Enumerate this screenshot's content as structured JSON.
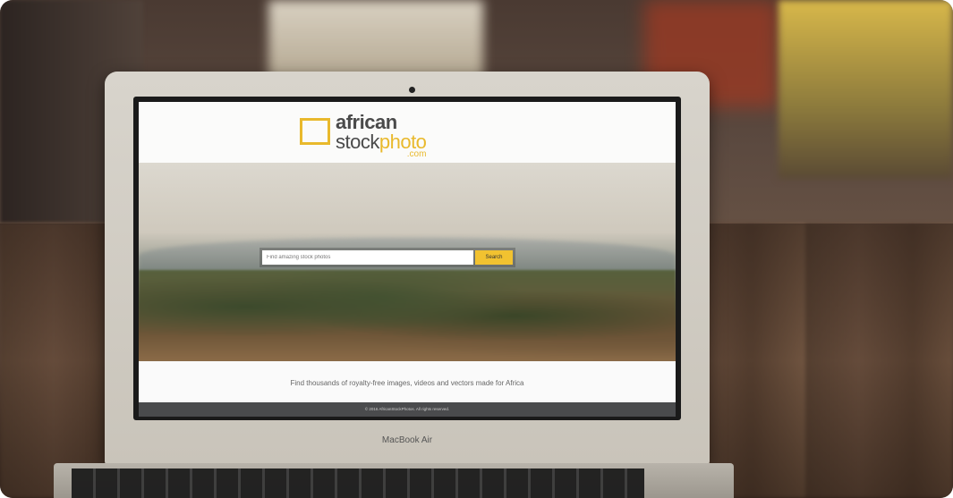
{
  "site": {
    "logo_line1": "african",
    "logo_line2_a": "stock",
    "logo_line2_b": "photo",
    "logo_line3": ".com"
  },
  "search": {
    "placeholder": "Find amazing stock photos",
    "button_label": "Search"
  },
  "tagline": "Find thousands of royalty-free images, videos and vectors made for Africa",
  "footer": "© 2016 AfricanStockPhotos. All rights reserved.",
  "device_label": "MacBook Air",
  "colors": {
    "accent": "#f2c230",
    "footer_bg": "#4a4b4d"
  }
}
